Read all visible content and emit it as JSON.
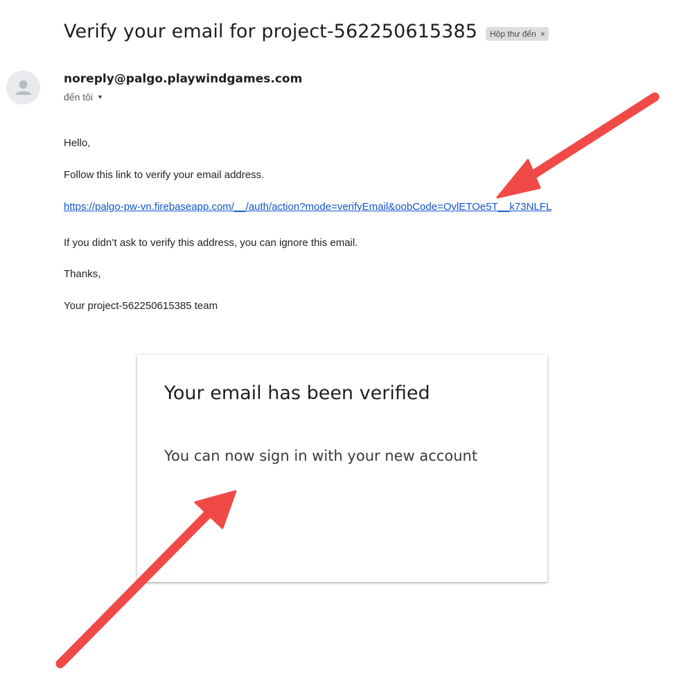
{
  "email": {
    "subject": "Verify your email for project-562250615385",
    "label_chip": "Hộp thư đến",
    "label_chip_close": "×",
    "sender": "noreply@palgo.playwindgames.com",
    "recipient": "đến tôi",
    "body": {
      "greeting": "Hello,",
      "instruction": "Follow this link to verify your email address.",
      "link": "https://palgo-pw-vn.firebaseapp.com/__/auth/action?mode=verifyEmail&oobCode=OylETOe5T__k73NLFL",
      "ignore_note": "If you didn’t ask to verify this address, you can ignore this email.",
      "thanks": "Thanks,",
      "signature": "Your project-562250615385 team"
    }
  },
  "verification_card": {
    "title": "Your email has been verified",
    "message": "You can now sign in with your new account"
  },
  "icons": {
    "avatar": "person-icon",
    "recipient_toggle": "caret-down-icon",
    "annotations": "arrow-icon"
  },
  "colors": {
    "link": "#1155cc",
    "arrow": "#f04a47",
    "chip_bg": "#dddddd",
    "avatar_bg": "#e8eaed"
  }
}
